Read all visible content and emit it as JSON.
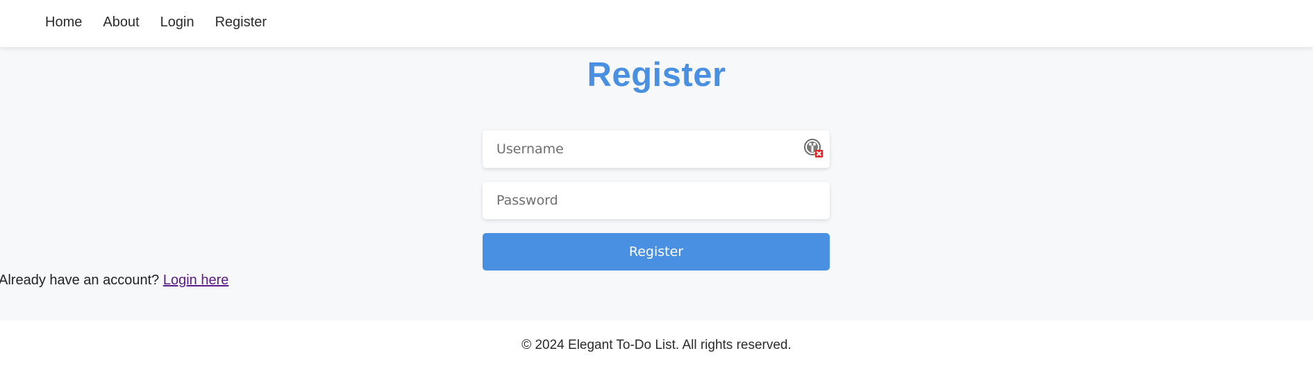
{
  "nav": {
    "items": [
      {
        "label": "Home"
      },
      {
        "label": "About"
      },
      {
        "label": "Login"
      },
      {
        "label": "Register"
      }
    ]
  },
  "page": {
    "title": "Register"
  },
  "form": {
    "username": {
      "placeholder": "Username",
      "value": ""
    },
    "password": {
      "placeholder": "Password",
      "value": ""
    },
    "submit_label": "Register"
  },
  "login_prompt": {
    "text": "Already have an account? ",
    "link_label": "Login here"
  },
  "footer": {
    "text": "© 2024 Elegant To-Do List. All rights reserved."
  },
  "colors": {
    "accent": "#4a90e2",
    "visited_link": "#5b1a8a",
    "background": "#f7f8fa"
  },
  "icons": {
    "username_field": "password-manager-error-icon"
  }
}
